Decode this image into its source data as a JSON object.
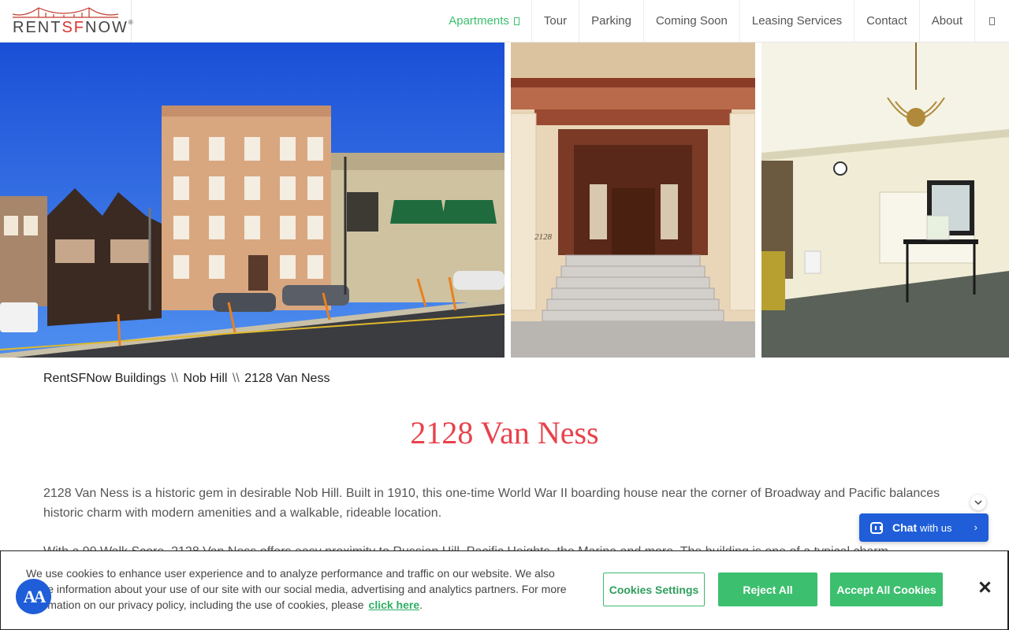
{
  "brand": {
    "logo_text_a": "RENT",
    "logo_text_b": "SF",
    "logo_text_c": "NOW",
    "logo_reg": "®",
    "accent": "#3cbf6e",
    "logo_red": "#d9342b"
  },
  "nav": {
    "items": [
      {
        "label": "Apartments",
        "active": true
      },
      {
        "label": "Tour"
      },
      {
        "label": "Parking"
      },
      {
        "label": "Coming Soon"
      },
      {
        "label": "Leasing Services"
      },
      {
        "label": "Contact"
      },
      {
        "label": "About"
      }
    ]
  },
  "photos": [
    {
      "subject": "building-exterior"
    },
    {
      "subject": "entrance-steps",
      "address_number": "2128"
    },
    {
      "subject": "lobby-interior"
    }
  ],
  "breadcrumb": {
    "items": [
      "RentSFNow Buildings",
      "Nob Hill",
      "2128 Van Ness"
    ],
    "separator": "\\\\"
  },
  "page": {
    "title": "2128 Van Ness",
    "title_color": "#e8424c",
    "description": "2128 Van Ness is a historic gem in desirable Nob Hill. Built in 1910, this one-time World War II boarding house near the corner of Broadway and Pacific balances historic charm with modern amenities and a walkable, rideable location.",
    "description_2": "With a 99 Walk Score, 2128 Van Ness offers easy proximity to Russian Hill, Pacific Heights, the Marina and more. The building is one of a typical charm..."
  },
  "chat": {
    "label_bold": "Chat",
    "label_light": "with us",
    "color": "#1f5ed8"
  },
  "cookie_banner": {
    "text": "We use cookies to enhance user experience and to analyze performance and traffic on our website. We also share information about your use of our site with our social media, advertising and analytics partners. For more information on our privacy policy, including the use of cookies, please",
    "link": "click here",
    "link_suffix": ".",
    "settings_button": "Cookies Settings",
    "reject_button": "Reject All",
    "accept_button": "Accept All Cookies"
  },
  "accessibility": {
    "label": "AA"
  }
}
